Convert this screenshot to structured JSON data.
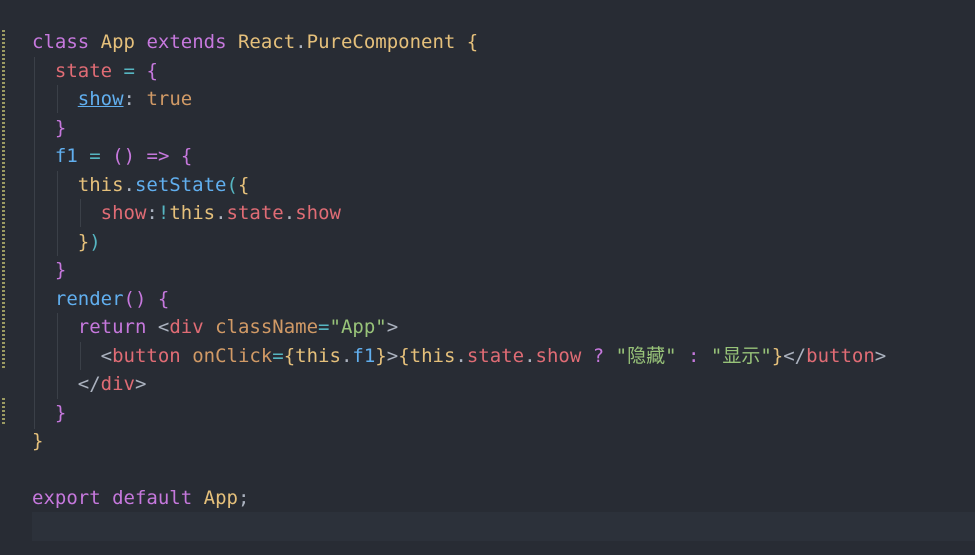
{
  "editor": {
    "tokens": {
      "l1": [
        "class",
        "App",
        "extends",
        "React",
        ".",
        "PureComponent",
        "{"
      ],
      "l2": [
        "state",
        "=",
        "{"
      ],
      "l3": [
        "show",
        ":",
        "true"
      ],
      "l4": [
        "}"
      ],
      "l5": [
        "f1",
        "=",
        "(",
        ")",
        "=>",
        "{"
      ],
      "l6": [
        "this",
        ".",
        "setState",
        "(",
        "{"
      ],
      "l7": [
        "show",
        ":",
        "!",
        "this",
        ".",
        "state",
        ".",
        "show"
      ],
      "l8": [
        "}",
        ")"
      ],
      "l9": [
        "}"
      ],
      "l10": [
        "render",
        "(",
        ")",
        "{"
      ],
      "l11": [
        "return",
        "<",
        "div",
        "className",
        "=",
        "\"App\"",
        ">"
      ],
      "l12": [
        "<",
        "button",
        "onClick",
        "=",
        "{",
        "this",
        ".",
        "f1",
        "}",
        ">",
        "{",
        "this",
        ".",
        "state",
        ".",
        "show",
        "?",
        "\"隐藏\"",
        ":",
        "\"显示\"",
        "}",
        "</",
        "button",
        ">"
      ],
      "l13": [
        "</",
        "div",
        ">"
      ],
      "l14": [
        "}"
      ],
      "l15": [
        "}"
      ],
      "l17": [
        "export",
        "default",
        "App",
        ";"
      ]
    }
  },
  "colors": {
    "background": "#282c34",
    "keyword": "#c678dd",
    "class": "#e5c07b",
    "property": "#e06c75",
    "function": "#61afef",
    "string": "#98c379",
    "operator": "#56b6c2"
  }
}
